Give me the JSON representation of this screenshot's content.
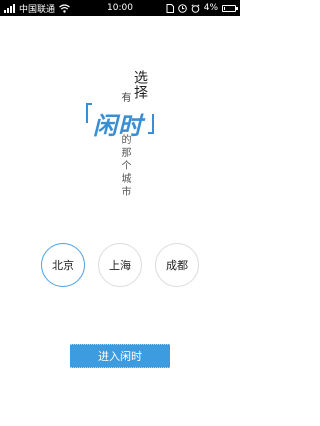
{
  "status_bar": {
    "carrier": "中国联通",
    "time": "10:00",
    "battery": "4%",
    "battery_level": 0.04,
    "icons": [
      "signal-icon",
      "wifi-icon",
      "sim-icon",
      "clock-icon",
      "alarm-icon",
      "battery-icon"
    ]
  },
  "hero": {
    "select_text": "选择",
    "you_text": "有",
    "brand_text": "闲时",
    "rest_text": "的那个城市"
  },
  "cities": [
    {
      "label": "北京",
      "selected": true
    },
    {
      "label": "上海",
      "selected": false
    },
    {
      "label": "成都",
      "selected": false
    }
  ],
  "enter_button": {
    "label": "进入闲时"
  },
  "colors": {
    "accent": "#3d9be0",
    "selected_ring": "#4aa3e6",
    "ring": "#dcdcdc"
  }
}
